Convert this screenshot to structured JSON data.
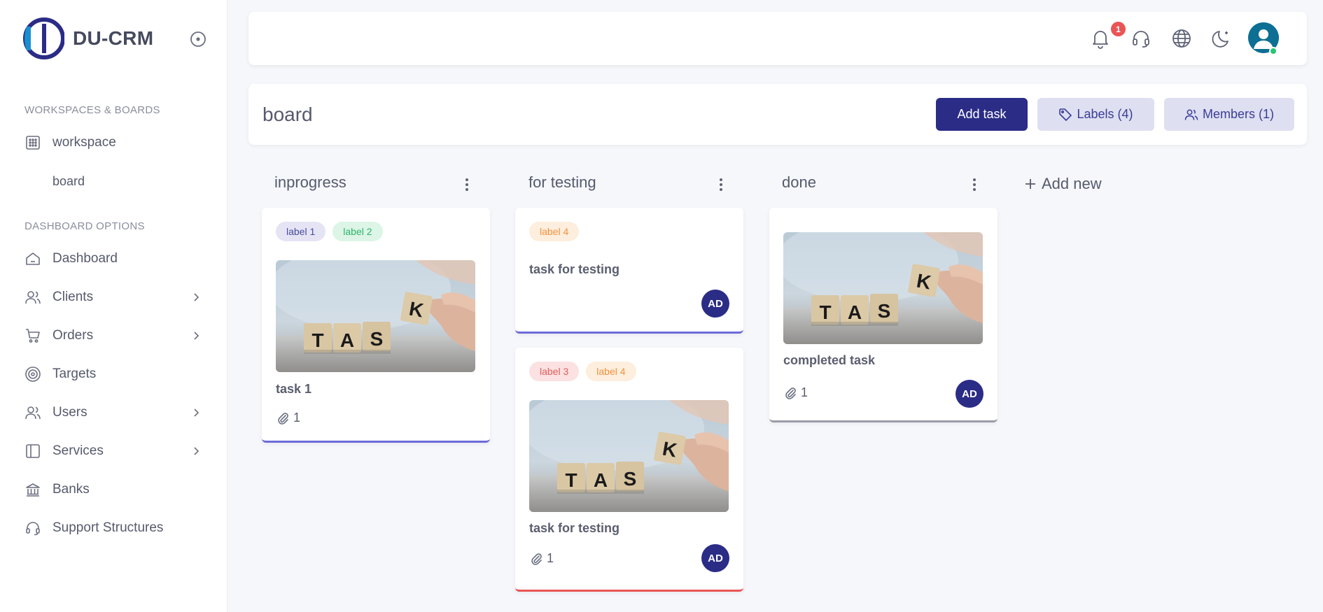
{
  "app": {
    "brand": "DU-CRM"
  },
  "sidebar": {
    "workspace_section": "WORKSPACES & BOARDS",
    "workspace_item": "workspace",
    "board_item": "board",
    "dashboard_section": "DASHBOARD OPTIONS",
    "items": [
      {
        "label": "Dashboard",
        "icon": "home-icon",
        "has_submenu": false
      },
      {
        "label": "Clients",
        "icon": "users-icon",
        "has_submenu": true
      },
      {
        "label": "Orders",
        "icon": "cart-icon",
        "has_submenu": true
      },
      {
        "label": "Targets",
        "icon": "target-icon",
        "has_submenu": false
      },
      {
        "label": "Users",
        "icon": "users-icon",
        "has_submenu": true
      },
      {
        "label": "Services",
        "icon": "layout-icon",
        "has_submenu": true
      },
      {
        "label": "Banks",
        "icon": "bank-icon",
        "has_submenu": false
      },
      {
        "label": "Support Structures",
        "icon": "headset-icon",
        "has_submenu": false
      }
    ]
  },
  "topbar": {
    "notification_count": "1",
    "icons": [
      "bell-icon",
      "headset-icon",
      "globe-icon",
      "moon-icon",
      "user-avatar"
    ]
  },
  "board": {
    "title": "board",
    "add_task_label": "Add task",
    "labels_label": "Labels (4)",
    "members_label": "Members (1)",
    "add_new_label": "Add new"
  },
  "columns": [
    {
      "title": "inprogress",
      "cards": [
        {
          "labels": [
            "label 1",
            "label 2"
          ],
          "image": true,
          "title": "task 1",
          "attachments": "1",
          "member": ""
        }
      ]
    },
    {
      "title": "for testing",
      "cards": [
        {
          "labels": [
            "label 4"
          ],
          "image": false,
          "title": "task for testing",
          "attachments": "",
          "member": "AD"
        },
        {
          "labels": [
            "label 3",
            "label 4"
          ],
          "image": true,
          "title": "task for testing",
          "attachments": "1",
          "member": "AD"
        }
      ]
    },
    {
      "title": "done",
      "cards": [
        {
          "labels": [],
          "image": true,
          "title": "completed task",
          "attachments": "1",
          "member": "AD"
        }
      ]
    }
  ],
  "task_image_letters": [
    "T",
    "A",
    "S",
    "K"
  ],
  "colors": {
    "primary": "#2b2c86",
    "label_purple": "#4a4aa0",
    "label_green": "#2db56a",
    "label_orange": "#f3923e",
    "label_red": "#e45c5c",
    "badge": "#ea5455",
    "online": "#28c76f"
  }
}
